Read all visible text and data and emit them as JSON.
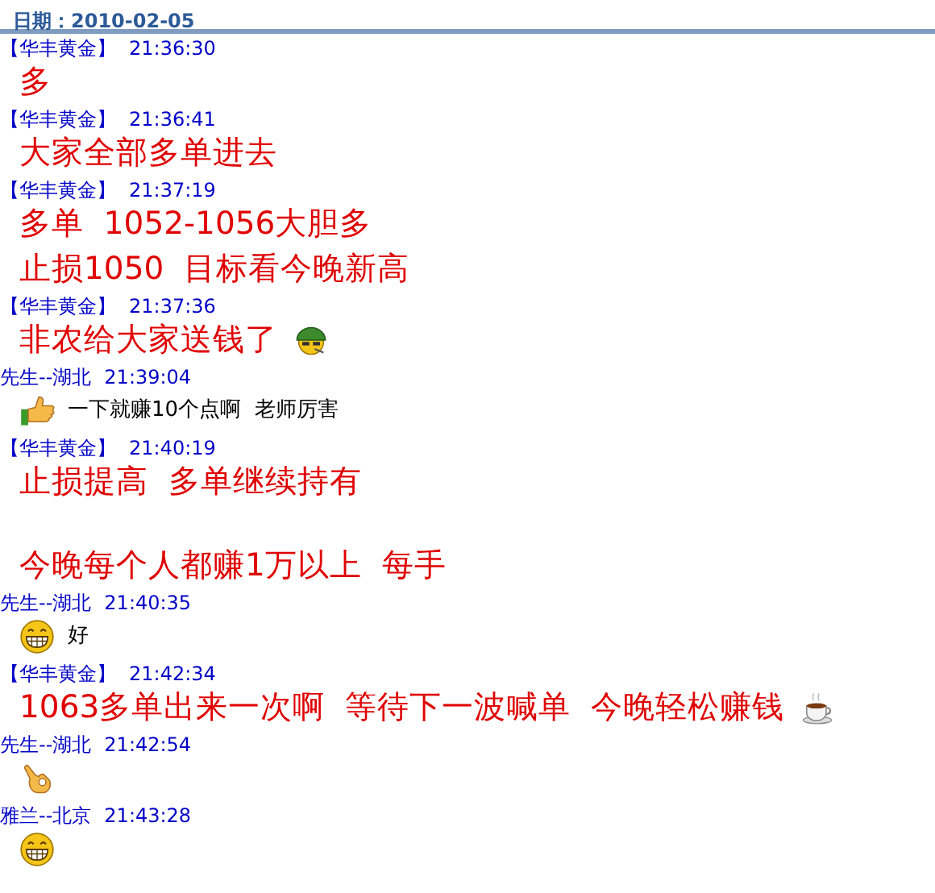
{
  "date_label": "日期：2010-02-05",
  "messages": [
    {
      "sender": "【华丰黄金】",
      "time": "21:36:30",
      "lines": [
        {
          "kind": "big",
          "text": "多"
        }
      ]
    },
    {
      "sender": "【华丰黄金】",
      "time": "21:36:41",
      "lines": [
        {
          "kind": "big",
          "text": "大家全部多单进去"
        }
      ]
    },
    {
      "sender": "【华丰黄金】",
      "time": "21:37:19",
      "lines": [
        {
          "kind": "big",
          "text": "多单  1052-1056大胆多"
        },
        {
          "kind": "big",
          "text": "止损1050  目标看今晚新高"
        }
      ]
    },
    {
      "sender": "【华丰黄金】",
      "time": "21:37:36",
      "lines": [
        {
          "kind": "big",
          "text": "非农给大家送钱了"
        }
      ]
    },
    {
      "sender": "先生--湖北",
      "time": "21:39:04",
      "lines": [
        {
          "kind": "small",
          "text": "一下就赚10个点啊  老师厉害"
        }
      ]
    },
    {
      "sender": "【华丰黄金】",
      "time": "21:40:19",
      "lines": [
        {
          "kind": "big",
          "text": "止损提高  多单继续持有"
        },
        {
          "kind": "gap"
        },
        {
          "kind": "big",
          "text": "今晚每个人都赚1万以上  每手"
        }
      ]
    },
    {
      "sender": "先生--湖北",
      "time": "21:40:35",
      "lines": [
        {
          "kind": "small",
          "text": "好"
        }
      ]
    },
    {
      "sender": "【华丰黄金】",
      "time": "21:42:34",
      "lines": [
        {
          "kind": "big",
          "text": "1063多单出来一次啊  等待下一波喊单  今晚轻松赚钱"
        }
      ]
    },
    {
      "sender": "先生--湖北",
      "time": "21:42:54",
      "lines": [
        {
          "kind": "small"
        }
      ]
    },
    {
      "sender": "雅兰--北京",
      "time": "21:43:28",
      "lines": [
        {
          "kind": "small"
        }
      ]
    }
  ]
}
